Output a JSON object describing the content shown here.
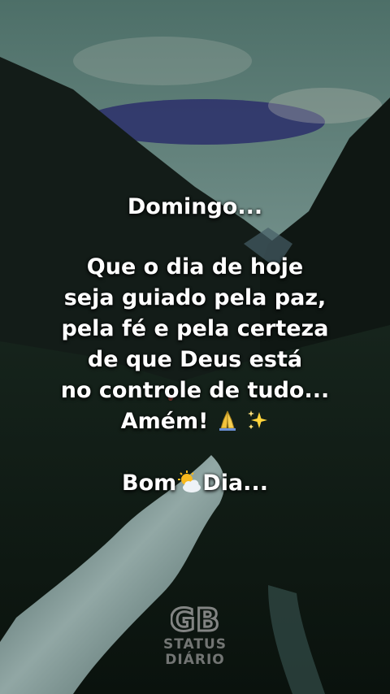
{
  "message": {
    "greeting": "Domingo...",
    "lines": [
      "Que o dia de hoje",
      "seja guiado pela paz,",
      "pela fé e pela certeza",
      "de que Deus está",
      "no controle de tudo..."
    ],
    "amen": "Amém!",
    "amen_emojis": [
      "praying-hands-icon",
      "sparkles-icon"
    ],
    "closing_prefix": "Bom",
    "closing_emoji": "sun-behind-cloud-icon",
    "closing_suffix": "Dia..."
  },
  "watermark": {
    "logo_letters": "GB",
    "line1": "STATUS",
    "line2": "DIÁRIO"
  },
  "colors": {
    "text": "#ffffff",
    "sky": "#5e7f7a",
    "mountains": "#0f1513",
    "river": "#9fb8b5"
  }
}
